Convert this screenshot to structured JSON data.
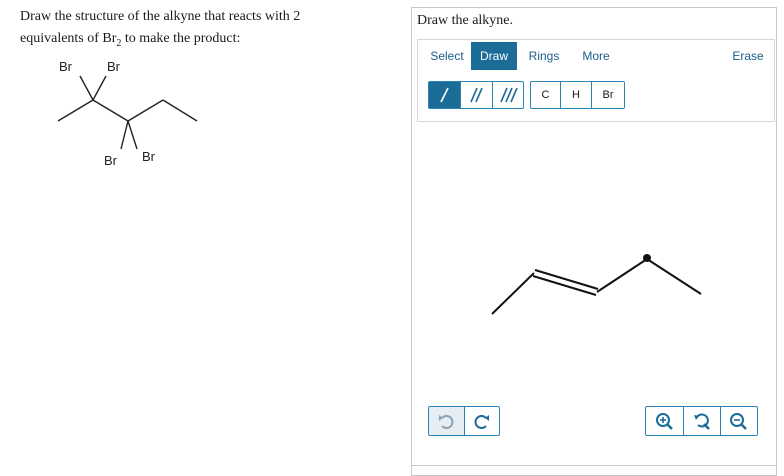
{
  "question": {
    "line1": "Draw the structure of the alkyne that reacts with 2",
    "line2_pre": "equivalents of Br",
    "line2_sub": "2",
    "line2_post": " to make the product:",
    "labels": [
      "Br",
      "Br",
      "Br",
      "Br"
    ]
  },
  "panel": {
    "title": "Draw the alkyne.",
    "tabs": [
      "Select",
      "Draw",
      "Rings",
      "More",
      "Erase"
    ],
    "active_tab": "Draw",
    "atoms": [
      "C",
      "H",
      "Br"
    ]
  },
  "icons": {
    "single_bond": "single-bond-icon",
    "double_bond": "double-bond-icon",
    "triple_bond": "triple-bond-icon",
    "undo": "undo-icon",
    "redo": "redo-icon",
    "zoom_in": "zoom-in-icon",
    "reset_zoom": "reset-zoom-icon",
    "zoom_out": "zoom-out-icon"
  },
  "colors": {
    "accent": "#1b6c97",
    "border": "#2c84b5"
  }
}
